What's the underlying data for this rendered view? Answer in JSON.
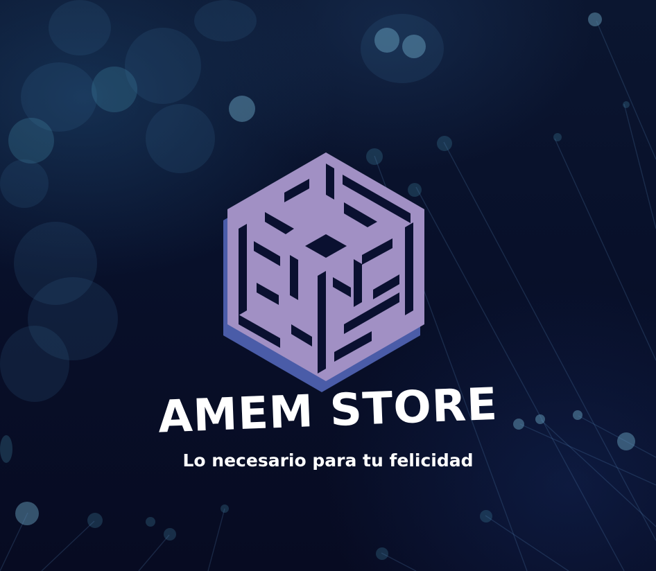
{
  "brand": {
    "name": "AMEM STORE",
    "tagline": "Lo necesario para tu felicidad",
    "logo_icon": "hexagon-cube-maze-logo-icon"
  },
  "colors": {
    "logo_face": "#a190c4",
    "logo_shadow": "#4a5ca8",
    "background": "#070b22",
    "text": "#ffffff"
  }
}
